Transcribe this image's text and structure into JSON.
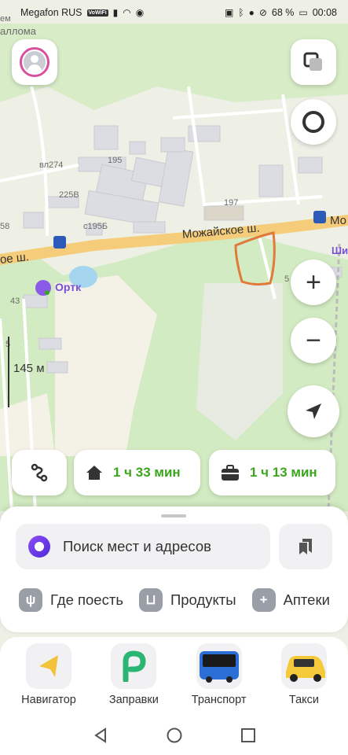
{
  "status_bar": {
    "carrier": "Megafon RUS",
    "volte": "VoWiFi",
    "battery": "68 %",
    "time": "00:08"
  },
  "map": {
    "labels": {
      "top_left_1": "ем",
      "top_left_2": "аллома",
      "vl274": "вл274",
      "b195": "195",
      "b225v": "225В",
      "c195b": "с195Б",
      "b197": "197",
      "b58": "58",
      "b43": "43",
      "b5": "5",
      "b5r": "5",
      "road_main": "Можайское ш.",
      "road_left": "ое ш.",
      "road_right": "Мо",
      "shi": "Ши",
      "poi_ortk": "Ортк"
    },
    "scale": "145 м"
  },
  "route_chips": {
    "home_time": "1 ч 33 мин",
    "work_time": "1 ч 13 мин"
  },
  "sheet": {
    "search_placeholder": "Поиск мест и адресов",
    "categories": [
      {
        "label": "Где поесть",
        "icon": "fork-knife-icon"
      },
      {
        "label": "Продукты",
        "icon": "basket-icon"
      },
      {
        "label": "Аптеки",
        "icon": "pharmacy-icon"
      }
    ]
  },
  "services": [
    {
      "label": "Навигатор",
      "icon": "navigator-arrow-icon"
    },
    {
      "label": "Заправки",
      "icon": "gas-station-icon"
    },
    {
      "label": "Транспорт",
      "icon": "bus-icon"
    },
    {
      "label": "Такси",
      "icon": "taxi-icon"
    }
  ],
  "colors": {
    "accent_green": "#3aa51d",
    "alice_purple": "#6b3be8",
    "road_yellow": "#f5cd7a",
    "annotation_orange": "#e07a3a"
  }
}
